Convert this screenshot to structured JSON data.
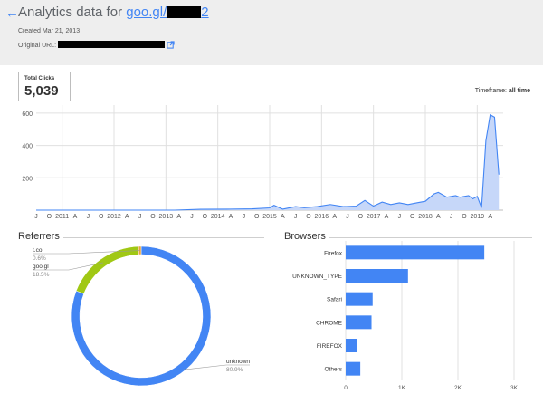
{
  "header": {
    "title_prefix": "Analytics data for ",
    "link_text": "goo.gl/",
    "link_suffix": "2",
    "created": "Created Mar 21, 2013",
    "original_url_label": "Original URL:"
  },
  "total_clicks": {
    "label": "Total Clicks",
    "value": "5,039"
  },
  "timeframe": {
    "label": "Timeframe:",
    "value": "all time"
  },
  "referrers": {
    "title": "Referrers"
  },
  "browsers": {
    "title": "Browsers"
  },
  "colors": {
    "accent": "#4285f4",
    "area_fill": "#c6d7f9",
    "lime": "#a0c814",
    "orange": "#e8a33d",
    "header_bg": "#eeeeee"
  },
  "chart_data": [
    {
      "type": "area",
      "ylim": [
        0,
        650
      ],
      "yticks": [
        200,
        400,
        600
      ],
      "grid": true,
      "x_tick_labels": [
        "J",
        "O",
        "2011",
        "A",
        "J",
        "O",
        "2012",
        "A",
        "J",
        "O",
        "2013",
        "A",
        "J",
        "O",
        "2014",
        "A",
        "J",
        "O",
        "2015",
        "A",
        "J",
        "O",
        "2016",
        "A",
        "J",
        "O",
        "2017",
        "A",
        "J",
        "O",
        "2018",
        "A",
        "J",
        "O",
        "2019",
        "A"
      ],
      "x_start": "2010-07",
      "x_end": "2019-07",
      "points": [
        [
          "2010-07",
          0
        ],
        [
          "2013-03",
          0
        ],
        [
          "2013-09",
          5
        ],
        [
          "2014-03",
          6
        ],
        [
          "2014-09",
          8
        ],
        [
          "2015-01",
          14
        ],
        [
          "2015-02",
          30
        ],
        [
          "2015-04",
          6
        ],
        [
          "2015-07",
          22
        ],
        [
          "2015-09",
          15
        ],
        [
          "2015-12",
          22
        ],
        [
          "2016-03",
          35
        ],
        [
          "2016-06",
          22
        ],
        [
          "2016-09",
          25
        ],
        [
          "2016-11",
          60
        ],
        [
          "2017-01",
          25
        ],
        [
          "2017-03",
          50
        ],
        [
          "2017-05",
          35
        ],
        [
          "2017-07",
          45
        ],
        [
          "2017-09",
          35
        ],
        [
          "2017-11",
          45
        ],
        [
          "2018-01",
          55
        ],
        [
          "2018-03",
          100
        ],
        [
          "2018-04",
          110
        ],
        [
          "2018-06",
          80
        ],
        [
          "2018-08",
          90
        ],
        [
          "2018-09",
          80
        ],
        [
          "2018-11",
          90
        ],
        [
          "2018-12",
          70
        ],
        [
          "2019-01",
          85
        ],
        [
          "2019-02",
          15
        ],
        [
          "2019-03",
          430
        ],
        [
          "2019-04",
          590
        ],
        [
          "2019-05",
          575
        ],
        [
          "2019-06",
          220
        ]
      ]
    },
    {
      "type": "pie",
      "slices": [
        {
          "label": "unknown",
          "percent": "80.9%",
          "value": 80.9,
          "color": "#4285f4"
        },
        {
          "label": "goo.gl",
          "percent": "18.5%",
          "value": 18.5,
          "color": "#a0c814"
        },
        {
          "label": "t.co",
          "percent": "0.6%",
          "value": 0.6,
          "color": "#e8a33d"
        }
      ]
    },
    {
      "type": "bar",
      "orientation": "horizontal",
      "categories": [
        "Firefox",
        "UNKNOWN_TYPE",
        "Safari",
        "CHROME",
        "FIREFOX",
        "Others"
      ],
      "values": [
        2470,
        1110,
        480,
        460,
        200,
        260
      ],
      "xlim": [
        0,
        3000
      ],
      "xticks": [
        0,
        1000,
        2000,
        3000
      ],
      "xtick_labels": [
        "0",
        "1K",
        "2K",
        "3K"
      ]
    }
  ]
}
